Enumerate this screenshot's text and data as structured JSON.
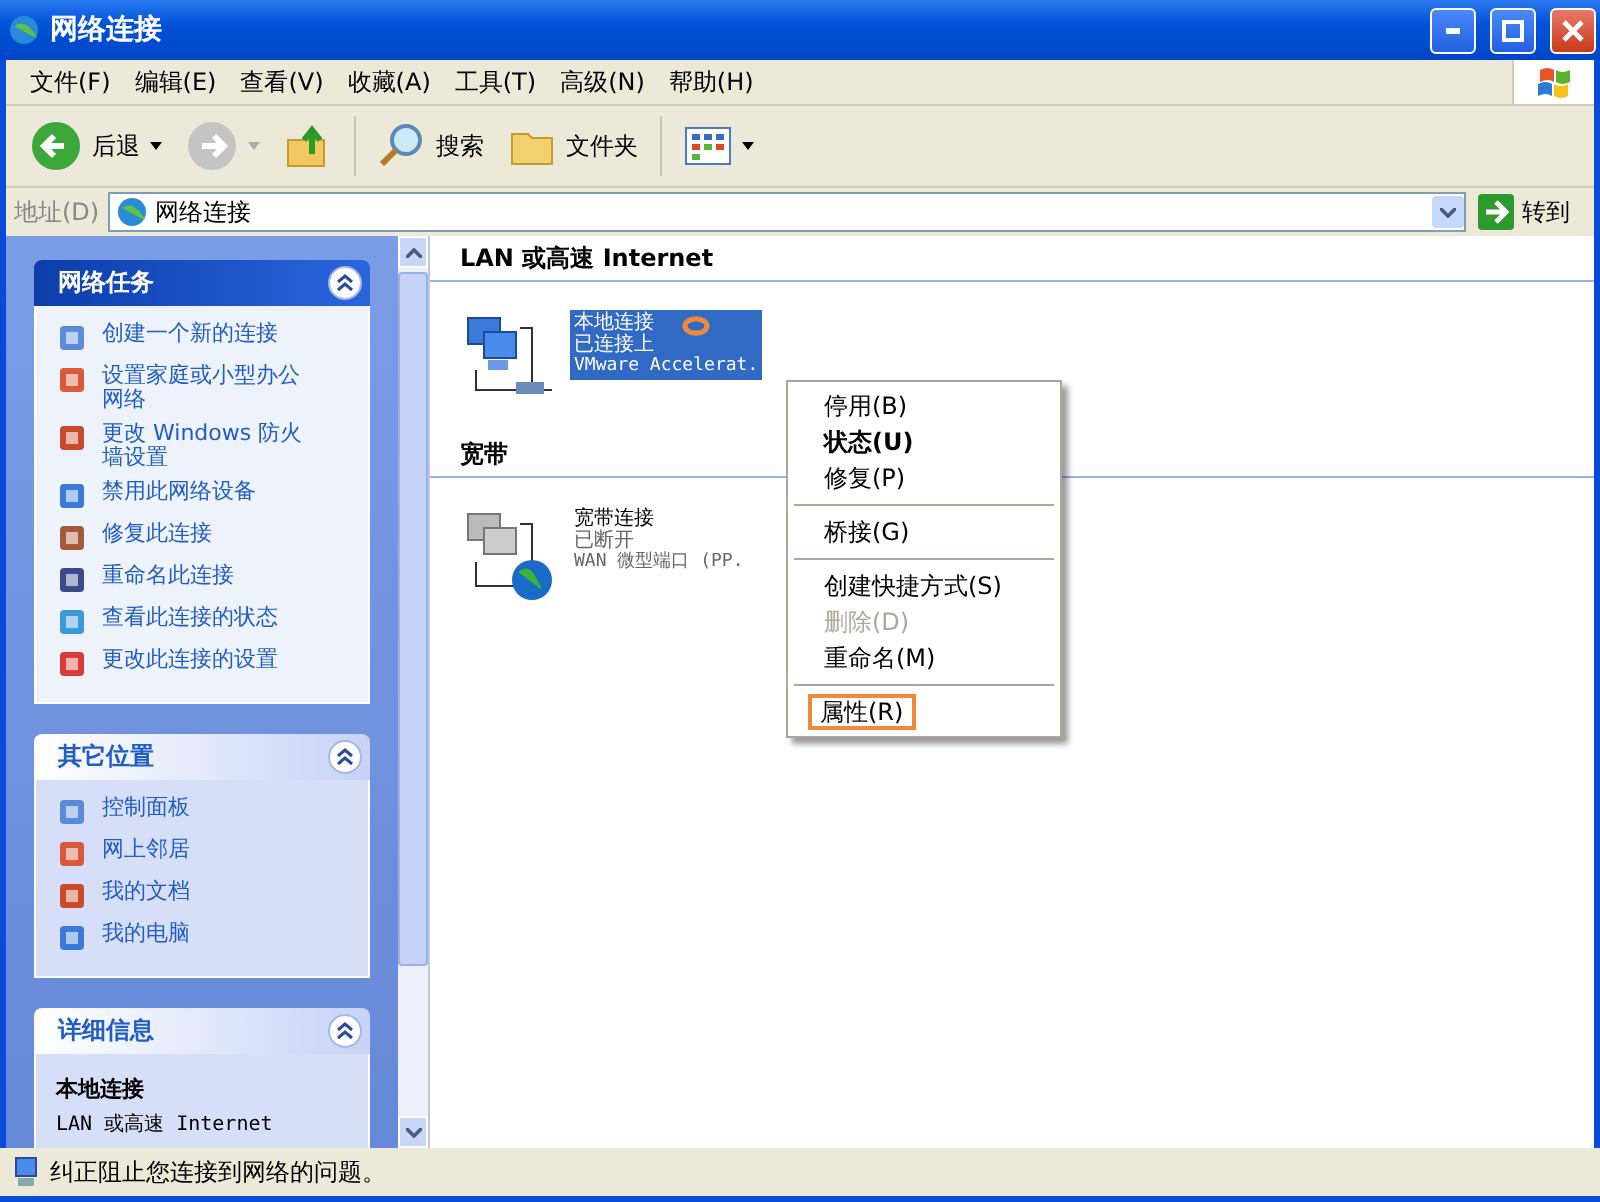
{
  "window": {
    "title": "网络连接"
  },
  "menu_bar": [
    "文件(F)",
    "编辑(E)",
    "查看(V)",
    "收藏(A)",
    "工具(T)",
    "高级(N)",
    "帮助(H)"
  ],
  "toolbar": [
    {
      "kind": "back",
      "label": "后退",
      "disabled": false
    },
    {
      "kind": "forward",
      "disabled": true
    },
    {
      "kind": "up",
      "disabled": false
    },
    {
      "kind": "search",
      "label": "搜索",
      "disabled": false
    },
    {
      "kind": "folders",
      "label": "文件夹",
      "disabled": false
    },
    {
      "kind": "views",
      "disabled": false
    }
  ],
  "address_bar": {
    "label": "地址(D)",
    "value": "网络连接",
    "go_button": "转到"
  },
  "sidebar": {
    "panels": [
      {
        "title": "网络任务",
        "special": true,
        "expanded": true,
        "items": [
          "创建一个新的连接",
          "设置家庭或小型办公网络",
          "更改 Windows 防火墙设置",
          "禁用此网络设备",
          "修复此连接",
          "重命名此连接",
          "查看此连接的状态",
          "更改此连接的设置"
        ]
      },
      {
        "title": "其它位置",
        "special": false,
        "expanded": true,
        "items": [
          "控制面板",
          "网上邻居",
          "我的文档",
          "我的电脑"
        ]
      },
      {
        "title": "详细信息",
        "special": false,
        "expanded": true,
        "details": {
          "name": "本地连接",
          "type": "LAN 或高速 Internet"
        }
      }
    ]
  },
  "content": {
    "groups": [
      {
        "title": "LAN 或高速 Internet",
        "connections": [
          {
            "kind": "lan",
            "name": "本地连接",
            "status": "已连接上",
            "device": "VMware Accelerat.",
            "selected": true,
            "marked": true
          }
        ]
      },
      {
        "title": "宽带",
        "connections": [
          {
            "kind": "broadband",
            "name": "宽带连接",
            "status": "已断开",
            "device": "WAN 微型端口 (PP.",
            "selected": false,
            "marked": false
          }
        ]
      }
    ]
  },
  "context_menu": [
    {
      "kind": "item",
      "label": "停用(B)",
      "bold": false,
      "disabled": false,
      "highlighted": false
    },
    {
      "kind": "item",
      "label": "状态(U)",
      "bold": true,
      "disabled": false,
      "highlighted": false
    },
    {
      "kind": "item",
      "label": "修复(P)",
      "bold": false,
      "disabled": false,
      "highlighted": false
    },
    {
      "kind": "separator"
    },
    {
      "kind": "item",
      "label": "桥接(G)",
      "bold": false,
      "disabled": false,
      "highlighted": false
    },
    {
      "kind": "separator"
    },
    {
      "kind": "item",
      "label": "创建快捷方式(S)",
      "bold": false,
      "disabled": false,
      "highlighted": false
    },
    {
      "kind": "item",
      "label": "删除(D)",
      "bold": false,
      "disabled": true,
      "highlighted": false
    },
    {
      "kind": "item",
      "label": "重命名(M)",
      "bold": false,
      "disabled": false,
      "highlighted": false
    },
    {
      "kind": "separator"
    },
    {
      "kind": "item",
      "label": "属性(R)",
      "bold": false,
      "disabled": false,
      "highlighted": true
    }
  ],
  "status_bar": {
    "text": "纠正阻止您连接到网络的问题。"
  }
}
